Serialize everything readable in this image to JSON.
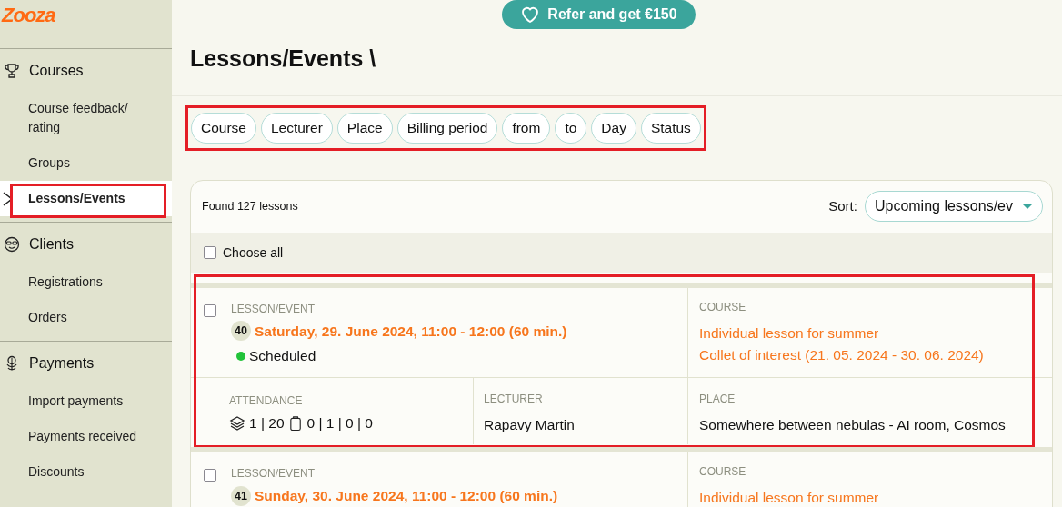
{
  "logo": {
    "text": "Zooza"
  },
  "sidebar": {
    "sections": [
      {
        "title": "Courses",
        "items": [
          {
            "label": "Course feedback/ rating",
            "selected": false,
            "highlighted": false
          },
          {
            "label": "Groups",
            "selected": false,
            "highlighted": false
          },
          {
            "label": "Lessons/Events",
            "selected": true,
            "highlighted": true
          }
        ]
      },
      {
        "title": "Clients",
        "items": [
          {
            "label": "Registrations",
            "selected": false,
            "highlighted": false
          },
          {
            "label": "Orders",
            "selected": false,
            "highlighted": false
          }
        ]
      },
      {
        "title": "Payments",
        "items": [
          {
            "label": "Import payments",
            "selected": false,
            "highlighted": false
          },
          {
            "label": "Payments received",
            "selected": false,
            "highlighted": false
          },
          {
            "label": "Discounts",
            "selected": false,
            "highlighted": false
          }
        ]
      }
    ]
  },
  "promo_button": {
    "label": "Refer and get €150"
  },
  "page_title": "Lessons/Events \\",
  "filters": {
    "highlighted": true,
    "chips": [
      "Course",
      "Lecturer",
      "Place",
      "Billing period",
      "from",
      "to",
      "Day",
      "Status"
    ]
  },
  "results": {
    "count_text": "Found 127 lessons",
    "sort_label": "Sort:",
    "sort_value": "Upcoming lessons/ev",
    "choose_all": {
      "label": "Choose all",
      "checked": false
    }
  },
  "lessons": [
    {
      "highlighted": true,
      "checked": false,
      "label": "LESSON/EVENT",
      "number": "40",
      "date": "Saturday, 29. June 2024, 11:00 - 12:00 (60 min.)",
      "status": {
        "label": "Scheduled",
        "color": "#22c33a"
      },
      "course_label": "COURSE",
      "course_lines": [
        "Individual lesson for summer",
        "Collet of interest (21. 05. 2024 - 30. 06. 2024)"
      ],
      "attendance_label": "ATTENDANCE",
      "attendance_groups": "1 | 20",
      "attendance_counts": "0 | 1 | 0 | 0",
      "lecturer_label": "LECTURER",
      "lecturer": "Rapavy Martin",
      "place_label": "PLACE",
      "place": "Somewhere between nebulas - AI room, Cosmos"
    },
    {
      "highlighted": false,
      "checked": false,
      "label": "LESSON/EVENT",
      "number": "41",
      "date": "Sunday, 30. June 2024, 11:00 - 12:00 (60 min.)",
      "course_label": "COURSE",
      "course_lines": [
        "Individual lesson for summer"
      ]
    }
  ]
}
